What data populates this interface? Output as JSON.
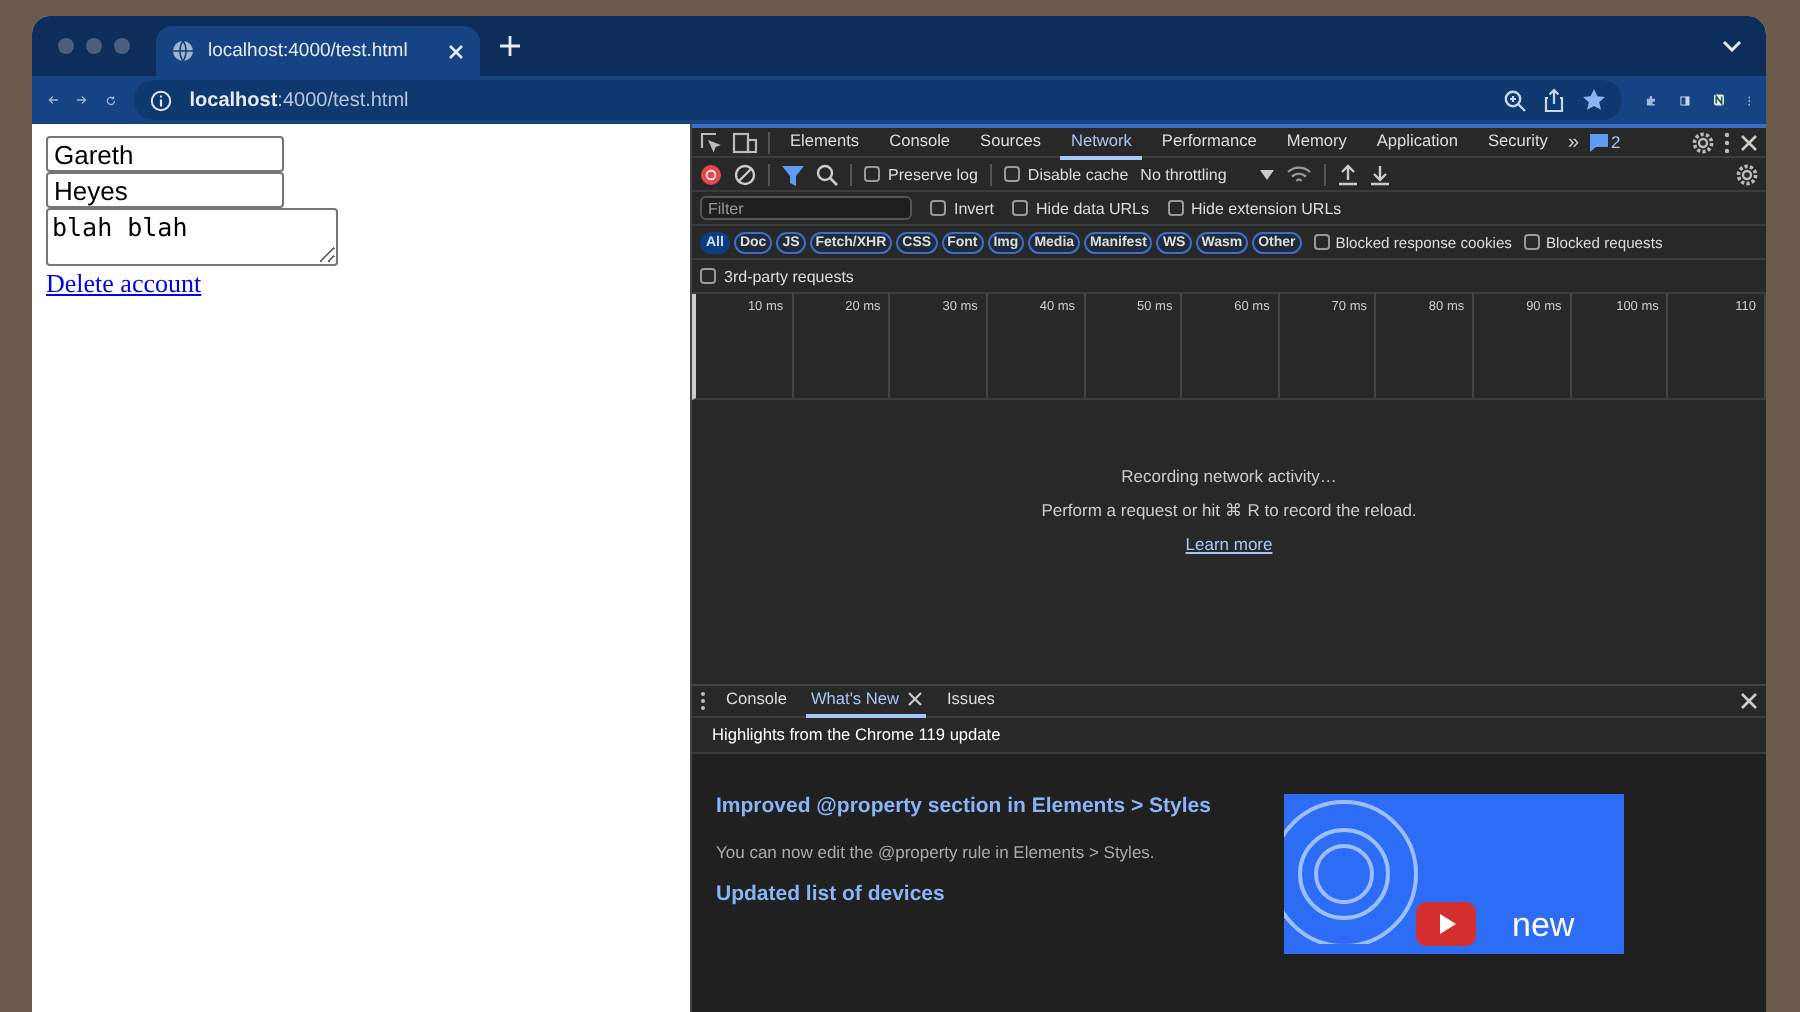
{
  "browser": {
    "tabs": [
      {
        "title": "localhost:4000/test.html",
        "selected": true
      }
    ],
    "address": {
      "host": "localhost",
      "path": ":4000/test.html"
    }
  },
  "page": {
    "fields": [
      {
        "kind": "input",
        "value": "Gareth"
      },
      {
        "kind": "input",
        "value": "Heyes"
      },
      {
        "kind": "textarea",
        "value": "blah blah"
      }
    ],
    "link": "Delete account"
  },
  "devtools": {
    "panels": [
      {
        "label": "Elements",
        "selected": false
      },
      {
        "label": "Console",
        "selected": false
      },
      {
        "label": "Sources",
        "selected": false
      },
      {
        "label": "Network",
        "selected": true
      },
      {
        "label": "Performance",
        "selected": false
      },
      {
        "label": "Memory",
        "selected": false
      },
      {
        "label": "Application",
        "selected": false
      },
      {
        "label": "Security",
        "selected": false
      }
    ],
    "more": "»",
    "issues_count": "2",
    "toolbar": [
      {
        "label": "Preserve log",
        "checked": false
      },
      {
        "label": "Disable cache",
        "checked": false
      }
    ],
    "throttling": "No throttling",
    "filter": {
      "placeholder": "Filter"
    },
    "filter_options": [
      {
        "label": "Invert",
        "checked": false
      },
      {
        "label": "Hide data URLs",
        "checked": false
      },
      {
        "label": "Hide extension URLs",
        "checked": false
      }
    ],
    "types": [
      {
        "label": "All",
        "selected": true
      },
      {
        "label": "Doc",
        "selected": false
      },
      {
        "label": "JS",
        "selected": false
      },
      {
        "label": "Fetch/XHR",
        "selected": false
      },
      {
        "label": "CSS",
        "selected": false
      },
      {
        "label": "Font",
        "selected": false
      },
      {
        "label": "Img",
        "selected": false
      },
      {
        "label": "Media",
        "selected": false
      },
      {
        "label": "Manifest",
        "selected": false
      },
      {
        "label": "WS",
        "selected": false
      },
      {
        "label": "Wasm",
        "selected": false
      },
      {
        "label": "Other",
        "selected": false
      }
    ],
    "blocked_options": [
      {
        "label": "Blocked response cookies",
        "checked": false
      },
      {
        "label": "Blocked requests",
        "checked": false
      }
    ],
    "third_party": {
      "label": "3rd-party requests",
      "checked": false
    },
    "timeline_ticks": [
      "10 ms",
      "20 ms",
      "30 ms",
      "40 ms",
      "50 ms",
      "60 ms",
      "70 ms",
      "80 ms",
      "90 ms",
      "100 ms",
      "110"
    ],
    "empty_state": {
      "status": "Recording network activity…",
      "hint": "Perform a request or hit ⌘ R to record the reload.",
      "link": "Learn more"
    },
    "drawer": {
      "tabs": [
        {
          "label": "Console",
          "selected": false,
          "closable": false
        },
        {
          "label": "What's New",
          "selected": true,
          "closable": true
        },
        {
          "label": "Issues",
          "selected": false,
          "closable": false
        }
      ],
      "header": "Highlights from the Chrome 119 update",
      "items": [
        {
          "kind": "heading",
          "text": "Improved @property section in Elements > Styles"
        },
        {
          "kind": "text",
          "text": "You can now edit the @property rule in Elements > Styles."
        },
        {
          "kind": "heading",
          "text": "Updated list of devices"
        }
      ],
      "video_caption": "new"
    }
  }
}
